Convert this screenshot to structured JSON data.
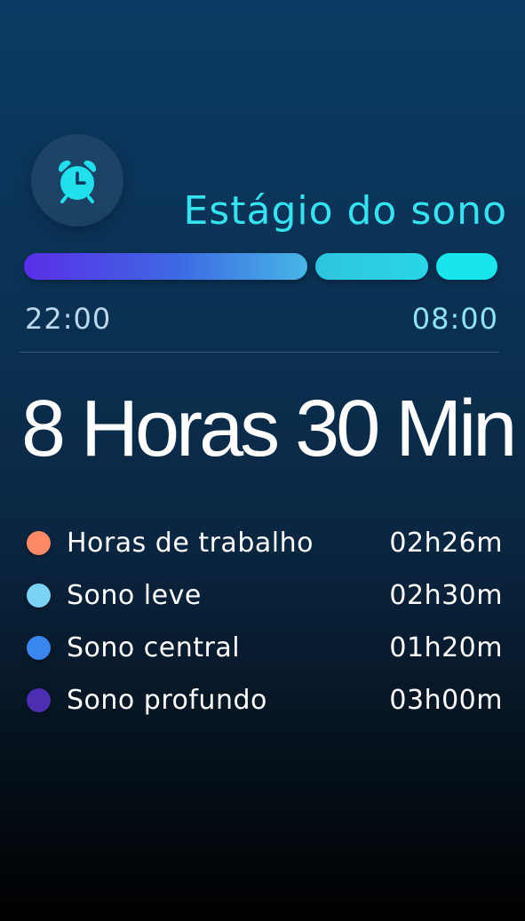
{
  "header": {
    "title": "Estágio do sono",
    "alarm_icon": "alarm-clock-icon",
    "accent_color": "#33e3ef"
  },
  "stage_bar": {
    "segments": [
      {
        "name": "segment-1",
        "share": 0.6,
        "color": "#5a2ee8"
      },
      {
        "name": "segment-2",
        "share": 0.24,
        "color": "#2ec4e0"
      },
      {
        "name": "segment-3",
        "share": 0.13,
        "color": "#17e6ee"
      }
    ],
    "start_time": "22:00",
    "end_time": "08:00"
  },
  "summary": {
    "total_duration": "8 Horas 30 Min"
  },
  "legend": [
    {
      "label": "Horas de trabalho",
      "value": "02h26m",
      "color": "#ff8a65"
    },
    {
      "label": "Sono leve",
      "value": "02h30m",
      "color": "#7ad3f5"
    },
    {
      "label": "Sono central",
      "value": "01h20m",
      "color": "#3a86f0"
    },
    {
      "label": "Sono profundo",
      "value": "03h00m",
      "color": "#4b2fb0"
    }
  ]
}
